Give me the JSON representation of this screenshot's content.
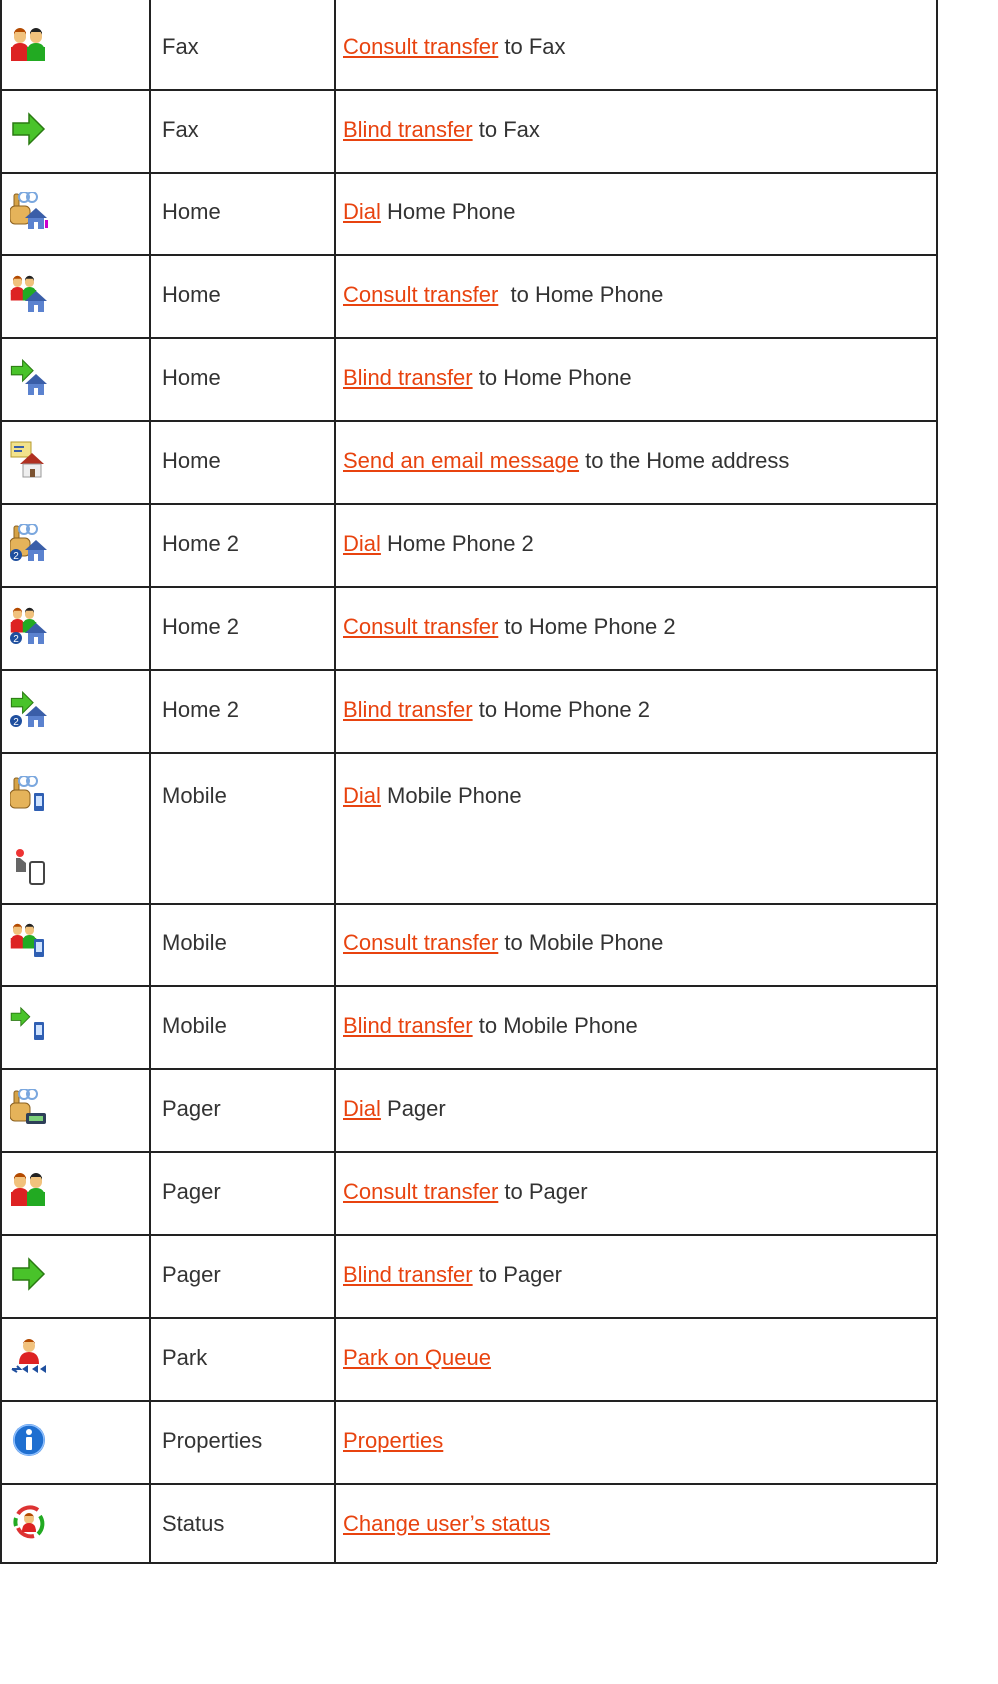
{
  "colors": {
    "link": "#e8430f",
    "text": "#333333",
    "border": "#222222"
  },
  "rows": [
    {
      "icon": "consult-transfer-icon",
      "type": "Fax",
      "link": "Consult transfer",
      "rest": " to Fax"
    },
    {
      "icon": "blind-transfer-arrow-icon",
      "type": "Fax",
      "link": "Blind transfer",
      "rest": " to Fax"
    },
    {
      "icon": "dial-home-icon",
      "type": "Home",
      "link": "Dial",
      "rest": " Home Phone"
    },
    {
      "icon": "consult-transfer-home-icon",
      "type": "Home",
      "link": "Consult transfer",
      "rest": "  to Home Phone"
    },
    {
      "icon": "blind-transfer-home-icon",
      "type": "Home",
      "link": "Blind transfer",
      "rest": " to Home Phone"
    },
    {
      "icon": "email-home-icon",
      "type": "Home",
      "link": "Send an email message",
      "rest": " to the Home address"
    },
    {
      "icon": "dial-home2-icon",
      "type": "Home 2",
      "link": "Dial",
      "rest": " Home Phone 2"
    },
    {
      "icon": "consult-transfer-home2-icon",
      "type": "Home 2",
      "link": "Consult transfer",
      "rest": " to Home Phone 2"
    },
    {
      "icon": "blind-transfer-home2-icon",
      "type": "Home 2",
      "link": "Blind transfer",
      "rest": " to Home Phone 2"
    },
    {
      "icon": "dial-mobile-icon",
      "icon2": "touch-mobile-icon",
      "type": "Mobile",
      "link": "Dial",
      "rest": " Mobile Phone"
    },
    {
      "icon": "consult-transfer-mobile-icon",
      "type": "Mobile",
      "link": "Consult transfer",
      "rest": " to Mobile Phone"
    },
    {
      "icon": "blind-transfer-mobile-icon",
      "type": "Mobile",
      "link": "Blind transfer",
      "rest": " to Mobile Phone"
    },
    {
      "icon": "dial-pager-icon",
      "type": "Pager",
      "link": "Dial",
      "rest": " Pager"
    },
    {
      "icon": "consult-transfer-icon",
      "type": "Pager",
      "link": "Consult transfer",
      "rest": " to Pager"
    },
    {
      "icon": "blind-transfer-arrow-icon",
      "type": "Pager",
      "link": "Blind transfer",
      "rest": " to Pager"
    },
    {
      "icon": "park-queue-icon",
      "type": "Park",
      "link": "Park on Queue",
      "rest": ""
    },
    {
      "icon": "info-icon",
      "type": "Properties",
      "link": "Properties",
      "rest": ""
    },
    {
      "icon": "change-status-icon",
      "type": "Status",
      "link": "Change user’s status",
      "rest": ""
    }
  ]
}
